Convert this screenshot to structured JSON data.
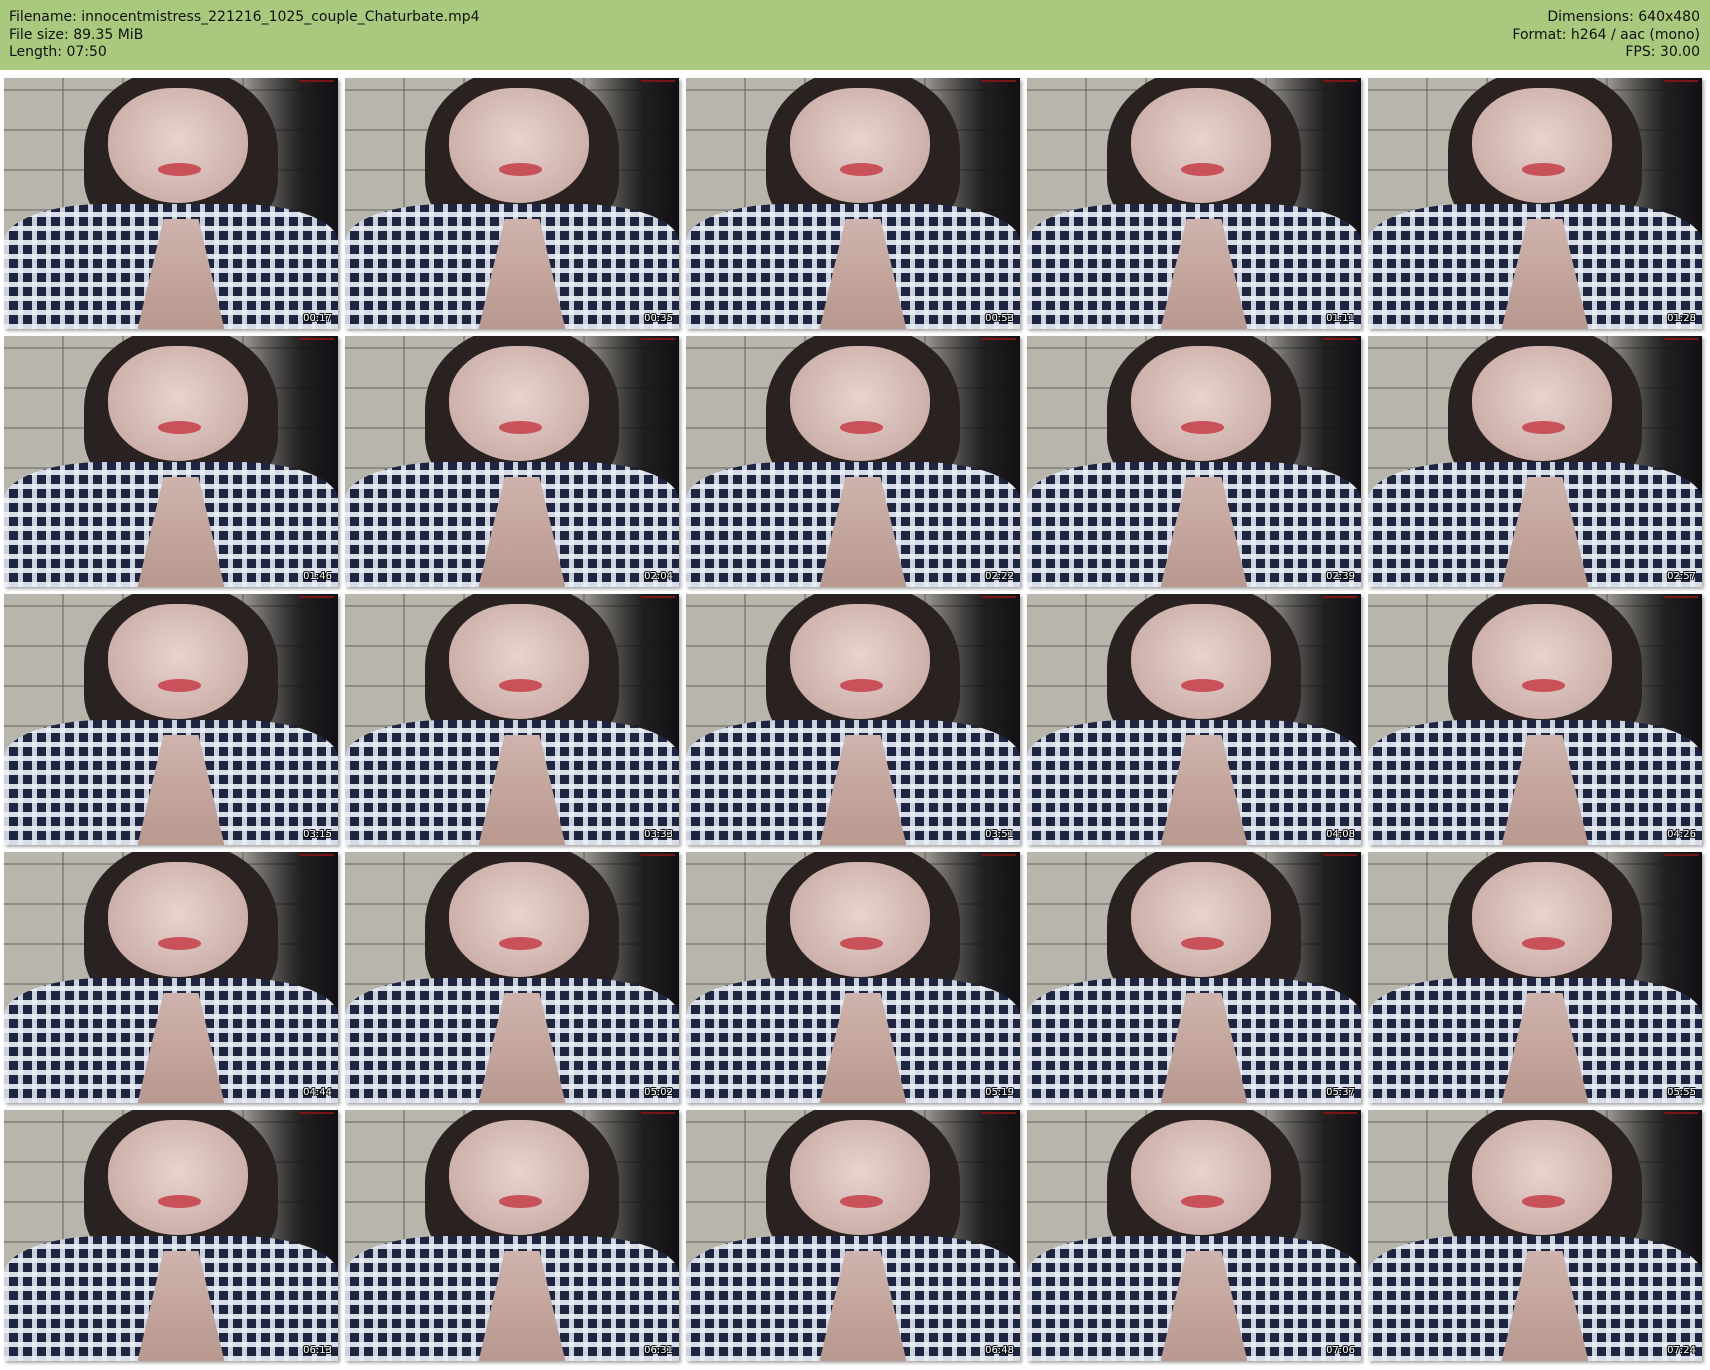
{
  "header": {
    "filename_line": "Filename: innocentmistress_221216_1025_couple_Chaturbate.mp4",
    "filesize_line": "File size: 89.35 MiB",
    "length_line": "Length: 07:50",
    "dimensions_line": "Dimensions: 640x480",
    "format_line": "Format: h264 / aac (mono)",
    "fps_line": "FPS: 30.00"
  },
  "colors": {
    "header_background": "#a9c97f",
    "page_background": "#ffffff",
    "timestamp_text": "#ffffff"
  },
  "thumbnails": [
    {
      "timestamp": "00:17"
    },
    {
      "timestamp": "00:35"
    },
    {
      "timestamp": "00:53"
    },
    {
      "timestamp": "01:11"
    },
    {
      "timestamp": "01:28"
    },
    {
      "timestamp": "01:46"
    },
    {
      "timestamp": "02:04"
    },
    {
      "timestamp": "02:22"
    },
    {
      "timestamp": "02:39"
    },
    {
      "timestamp": "02:57"
    },
    {
      "timestamp": "03:15"
    },
    {
      "timestamp": "03:33"
    },
    {
      "timestamp": "03:51"
    },
    {
      "timestamp": "04:08"
    },
    {
      "timestamp": "04:26"
    },
    {
      "timestamp": "04:44"
    },
    {
      "timestamp": "05:02"
    },
    {
      "timestamp": "05:19"
    },
    {
      "timestamp": "05:37"
    },
    {
      "timestamp": "05:55"
    },
    {
      "timestamp": "06:13"
    },
    {
      "timestamp": "06:31"
    },
    {
      "timestamp": "06:48"
    },
    {
      "timestamp": "07:06"
    },
    {
      "timestamp": "07:24"
    }
  ]
}
